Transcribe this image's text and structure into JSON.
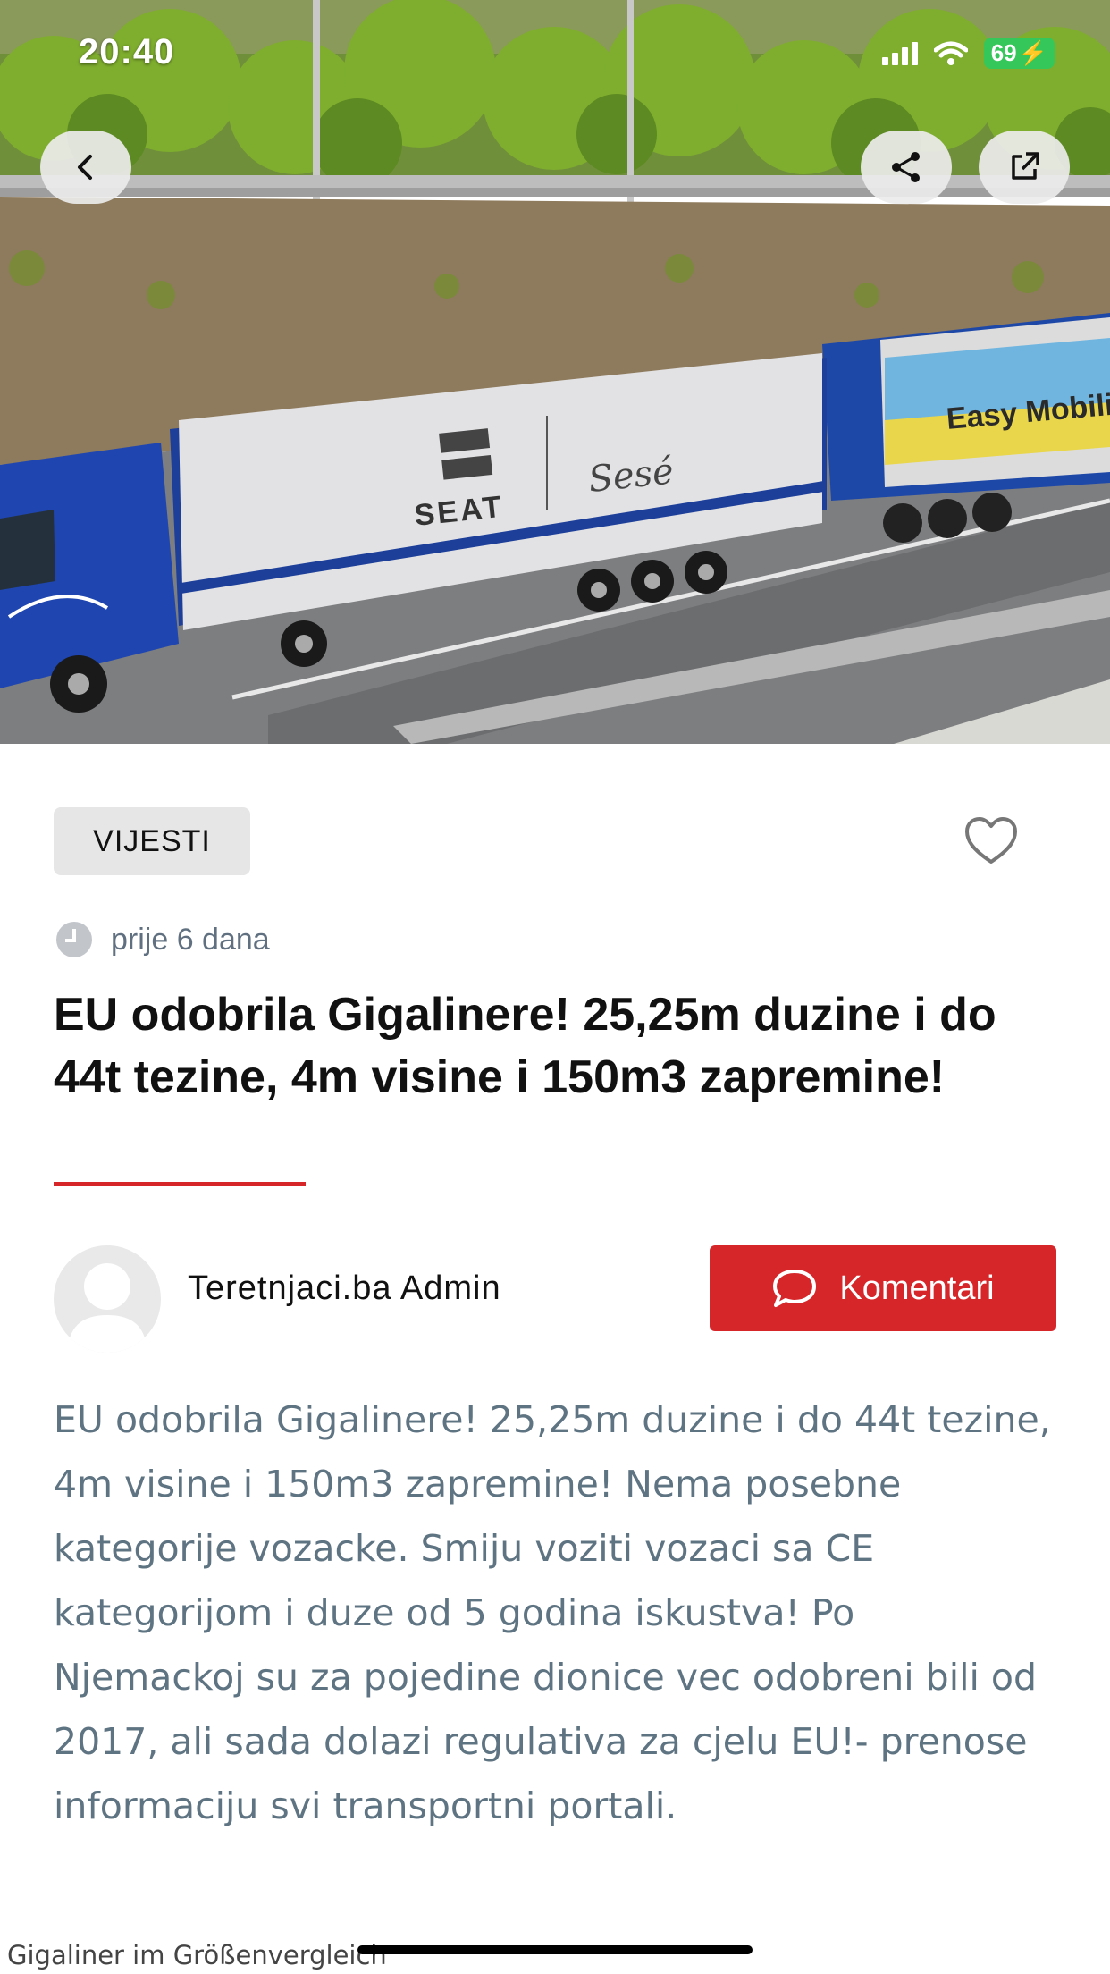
{
  "status_bar": {
    "time": "20:40",
    "battery": "69"
  },
  "hero": {
    "trailer_brand": "SEAT",
    "trailer_brand_secondary": "Sesé",
    "second_trailer_text": "Easy Mobility S"
  },
  "header_buttons": {
    "back": "back-icon",
    "share": "share-icon",
    "external": "external-link-icon"
  },
  "article": {
    "category": "VIJESTI",
    "time_ago": "prije 6 dana",
    "title": "EU odobrila Gigalinere! 25,25m duzine i do 44t tezine, 4m visine i 150m3 zapremine!",
    "author": "Teretnjaci.ba Admin",
    "comments_label": "Komentari",
    "body": "EU odobrila Gigalinere! 25,25m duzine i do 44t tezine, 4m visine i 150m3 zapremine! Nema posebne kategorije vozacke. Smiju voziti vozaci sa CE kategorijom i duze od 5 godina iskustva! Po Njemackoj su za pojedine dionice vec odobreni bili od 2017, ali sada dolazi regulativa za cjelu EU!- prenose informaciju svi transportni portali.",
    "image_caption": "Gigaliner im Größenvergleich"
  },
  "colors": {
    "accent": "#d7262a",
    "body_text": "#5f7482",
    "category_bg": "#e6e6e6"
  }
}
